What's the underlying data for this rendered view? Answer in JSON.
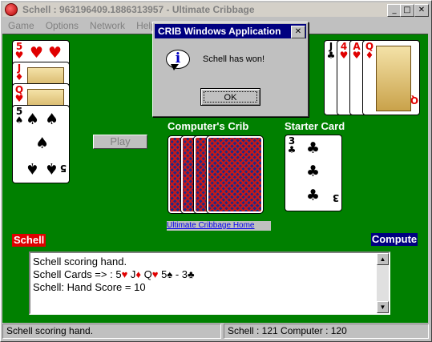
{
  "window": {
    "title": "Schell : 963196409.1886313957 - Ultimate Cribbage",
    "minimize": "_",
    "maximize": "□",
    "close": "✕"
  },
  "menu": [
    "Game",
    "Options",
    "Network",
    "Help"
  ],
  "player_hand": [
    {
      "rank": "5",
      "suit": "♥"
    },
    {
      "rank": "J",
      "suit": "♦"
    },
    {
      "rank": "Q",
      "suit": "♥"
    },
    {
      "rank": "5",
      "suit": "♠"
    }
  ],
  "computer_hand": [
    {
      "rank": "J",
      "suit": "♣"
    },
    {
      "rank": "4",
      "suit": "♥"
    },
    {
      "rank": "A",
      "suit": "♥"
    },
    {
      "rank": "Q",
      "suit": "♦"
    }
  ],
  "play_button": "Play",
  "crib": {
    "label": "Computer's Crib"
  },
  "starter": {
    "label": "Starter Card",
    "rank": "3",
    "suit": "♣"
  },
  "home_link": "Ultimate Cribbage Home",
  "player_tag": "Schell",
  "computer_tag": "Compute",
  "log": {
    "line1": "Schell scoring hand.",
    "line2a": "Schell Cards =>  : 5",
    "line2b": " J",
    "line2c": " Q",
    "line2d": " 5",
    "line2e": "  - 3",
    "line3": "Schell: Hand Score = 10",
    "heart": "♥",
    "diamond": "♦",
    "spade": "♠",
    "club": "♣"
  },
  "status": {
    "left": "Schell scoring hand.",
    "right": "Schell : 121 Computer : 120"
  },
  "dialog": {
    "title": "CRIB Windows Application",
    "message": "Schell  has won!",
    "ok": "OK",
    "info_glyph": "i",
    "close": "✕"
  }
}
